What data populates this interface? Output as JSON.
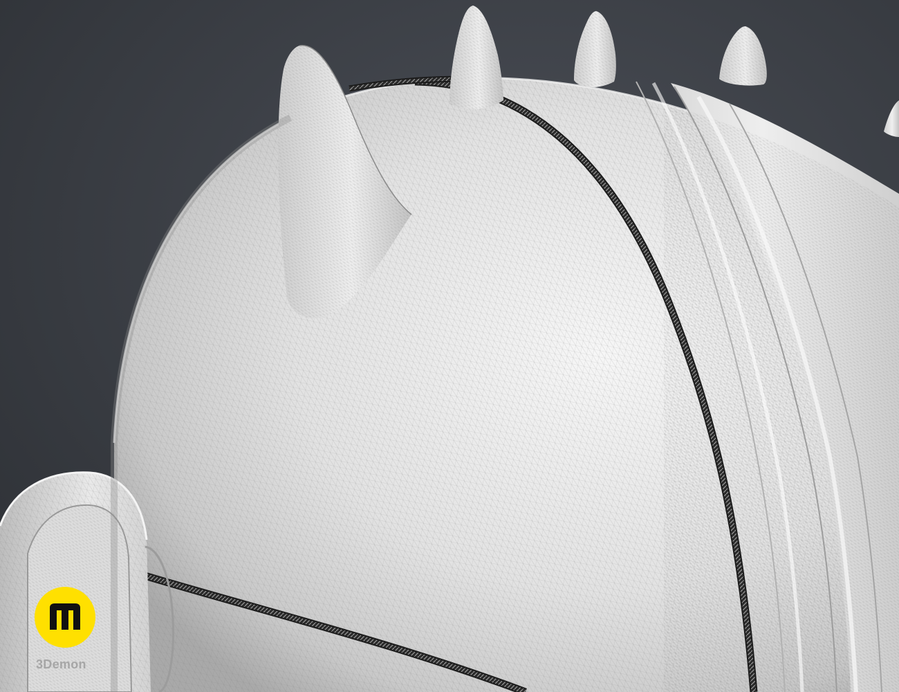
{
  "scene": {
    "subject": "helmet-wireframe-render",
    "background_color": "#3a3d44",
    "shell_color": "#e6e6e6",
    "wire_color": "#8c8c8c",
    "seam_color": "#1c1c1c"
  },
  "watermark": {
    "brand_text": "3Demon",
    "logo_color": "#ffe000",
    "logo_mark_color": "#111111"
  }
}
